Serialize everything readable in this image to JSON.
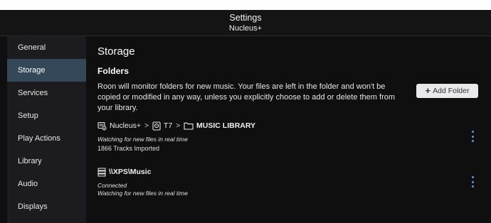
{
  "window": {
    "title": "Settings",
    "subtitle": "Nucleus+"
  },
  "sidebar": {
    "items": [
      {
        "label": "General"
      },
      {
        "label": "Storage"
      },
      {
        "label": "Services"
      },
      {
        "label": "Setup"
      },
      {
        "label": "Play Actions"
      },
      {
        "label": "Library"
      },
      {
        "label": "Audio"
      },
      {
        "label": "Displays"
      }
    ],
    "active": "Storage"
  },
  "main": {
    "heading": "Storage",
    "section_title": "Folders",
    "description": "Roon will monitor folders for new music. Your files are left in the folder and won't be copied or modified in any way, unless you explicitly choose to add or delete them from your library.",
    "add_folder_label": "Add Folder",
    "folders": [
      {
        "path": [
          {
            "icon": "server-icon",
            "label": "Nucleus+"
          },
          {
            "icon": "drive-icon",
            "label": "T7"
          },
          {
            "icon": "folder-icon",
            "label": "MUSIC LIBRARY"
          }
        ],
        "status": "Watching for new files in real time",
        "detail": "1866 Tracks Imported"
      },
      {
        "path": [
          {
            "icon": "network-share-icon",
            "label": "\\\\XPS\\Music"
          }
        ],
        "status": "Connected",
        "detail": "Watching for new files in real time"
      }
    ]
  },
  "colors": {
    "accent": "#5b9bd5",
    "active_item": "#34485a",
    "sidebar_bg": "#1c1c1e",
    "background": "#0f0f10"
  }
}
